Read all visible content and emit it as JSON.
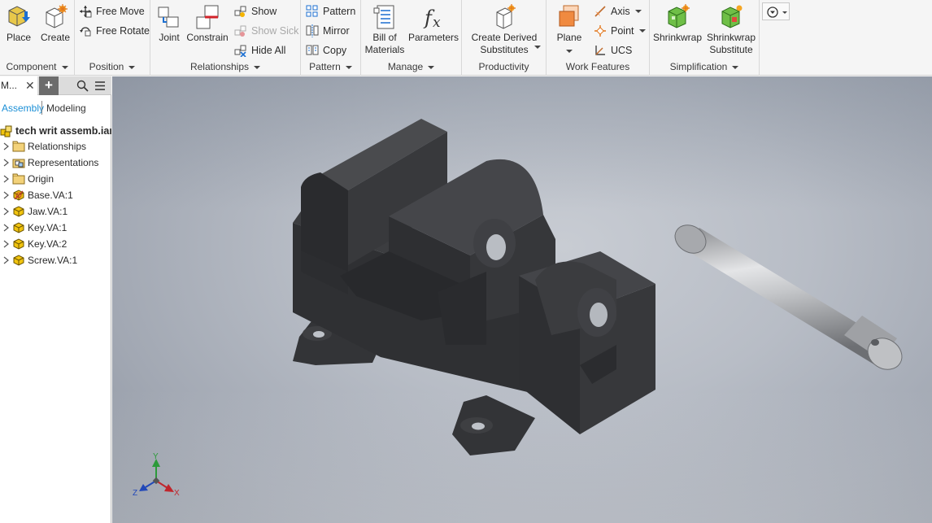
{
  "ribbon": {
    "panels": {
      "component": {
        "title": "Component",
        "place_label": "Place",
        "create_label": "Create"
      },
      "position": {
        "title": "Position",
        "free_move_label": "Free Move",
        "free_rotate_label": "Free Rotate"
      },
      "relationships": {
        "title": "Relationships",
        "joint_label": "Joint",
        "constrain_label": "Constrain",
        "show_label": "Show",
        "show_sick_label": "Show Sick",
        "hide_all_label": "Hide All"
      },
      "pattern": {
        "title": "Pattern",
        "pattern_label": "Pattern",
        "mirror_label": "Mirror",
        "copy_label": "Copy"
      },
      "manage": {
        "title": "Manage",
        "bom_label_1": "Bill of",
        "bom_label_2": "Materials",
        "parameters_label": "Parameters"
      },
      "productivity": {
        "title": "Productivity",
        "derived_label_1": "Create Derived",
        "derived_label_2": "Substitutes"
      },
      "work_features": {
        "title": "Work Features",
        "plane_label": "Plane",
        "axis_label": "Axis",
        "point_label": "Point",
        "ucs_label": "UCS"
      },
      "simplification": {
        "title": "Simplification",
        "shrinkwrap_label": "Shrinkwrap",
        "shrinkwrap_sub_label_1": "Shrinkwrap",
        "shrinkwrap_sub_label_2": "Substitute"
      }
    }
  },
  "browser": {
    "tab_label": "M...",
    "tab_close": "✕",
    "tab_add": "+",
    "mode_assembly": "Assembly",
    "mode_modeling": "Modeling",
    "root_label": "tech writ assemb.iam",
    "items": [
      {
        "label": "Relationships",
        "icon": "folder-icon"
      },
      {
        "label": "Representations",
        "icon": "representations-icon"
      },
      {
        "label": "Origin",
        "icon": "folder-icon"
      },
      {
        "label": "Base.VA:1",
        "icon": "grounded-part-icon"
      },
      {
        "label": "Jaw.VA:1",
        "icon": "part-icon"
      },
      {
        "label": "Key.VA:1",
        "icon": "part-icon"
      },
      {
        "label": "Key.VA:2",
        "icon": "part-icon"
      },
      {
        "label": "Screw.VA:1",
        "icon": "part-icon"
      }
    ]
  },
  "viewport": {
    "axis_labels": {
      "x": "X",
      "y": "Y",
      "z": "Z"
    },
    "colors": {
      "x_axis": "#c0262d",
      "y_axis": "#2c9a3a",
      "z_axis": "#2148b8",
      "part_dark": "#3a3b3d",
      "screw_metal": "#b7b9bc"
    }
  }
}
